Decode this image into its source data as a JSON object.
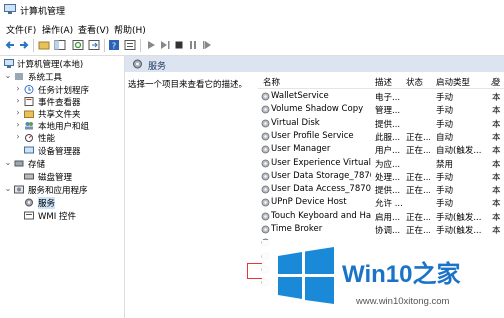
{
  "window": {
    "title": "计算机管理"
  },
  "menu": [
    "文件(F)",
    "操作(A)",
    "查看(V)",
    "帮助(H)"
  ],
  "toolbar": {
    "icons": [
      "back-icon",
      "forward-icon",
      "up-folder-icon",
      "show-tree-icon",
      "refresh-icon",
      "export-icon",
      "help-icon",
      "view-icon",
      "play-icon",
      "play-next-icon",
      "stop-icon",
      "pause-icon",
      "restart-icon"
    ]
  },
  "tree": {
    "root": "计算机管理(本地)",
    "system_tools": "系统工具",
    "task_scheduler": "任务计划程序",
    "event_viewer": "事件查看器",
    "shared_folders": "共享文件夹",
    "local_users": "本地用户和组",
    "performance": "性能",
    "device_manager": "设备管理器",
    "storage": "存储",
    "disk_management": "磁盘管理",
    "services_apps": "服务和应用程序",
    "services": "服务",
    "wmi": "WMI 控件"
  },
  "services_pane": {
    "header": "服务",
    "description_prompt": "选择一个项目来查看它的描述。",
    "columns": {
      "name": "名称",
      "desc": "描述",
      "status": "状态",
      "startup": "启动类型",
      "logon": "登"
    },
    "rows": [
      {
        "name": "WalletService",
        "desc": "电子...",
        "status": "",
        "startup": "手动",
        "logon": "本"
      },
      {
        "name": "Volume Shadow Copy",
        "desc": "管理...",
        "status": "",
        "startup": "手动",
        "logon": "本"
      },
      {
        "name": "Virtual Disk",
        "desc": "提供...",
        "status": "",
        "startup": "手动",
        "logon": "本"
      },
      {
        "name": "User Profile Service",
        "desc": "此服...",
        "status": "正在...",
        "startup": "自动",
        "logon": "本"
      },
      {
        "name": "User Manager",
        "desc": "用户...",
        "status": "正在...",
        "startup": "自动(触发...",
        "logon": "本"
      },
      {
        "name": "User Experience Virtualiz...",
        "desc": "为应...",
        "status": "",
        "startup": "禁用",
        "logon": "本"
      },
      {
        "name": "User Data Storage_7870e",
        "desc": "处理...",
        "status": "正在...",
        "startup": "手动",
        "logon": "本"
      },
      {
        "name": "User Data Access_7870e",
        "desc": "提供...",
        "status": "正在...",
        "startup": "手动",
        "logon": "本"
      },
      {
        "name": "UPnP Device Host",
        "desc": "允许 ...",
        "status": "",
        "startup": "手动",
        "logon": "本"
      },
      {
        "name": "Touch Keyboard and Ha...",
        "desc": "启用...",
        "status": "正在...",
        "startup": "手动(触发...",
        "logon": "本"
      },
      {
        "name": "Time Broker",
        "desc": "协调...",
        "status": "正在...",
        "startup": "手动(触发...",
        "logon": "本"
      }
    ]
  },
  "watermark": {
    "brand_main": "Win10",
    "brand_suffix": "之家",
    "url": "www.win10xitong.com"
  },
  "colors": {
    "header_bg": "#dbe4f0",
    "selection": "#cce4f7",
    "brand_blue": "#1a73c9",
    "red_mark": "#e53935"
  }
}
